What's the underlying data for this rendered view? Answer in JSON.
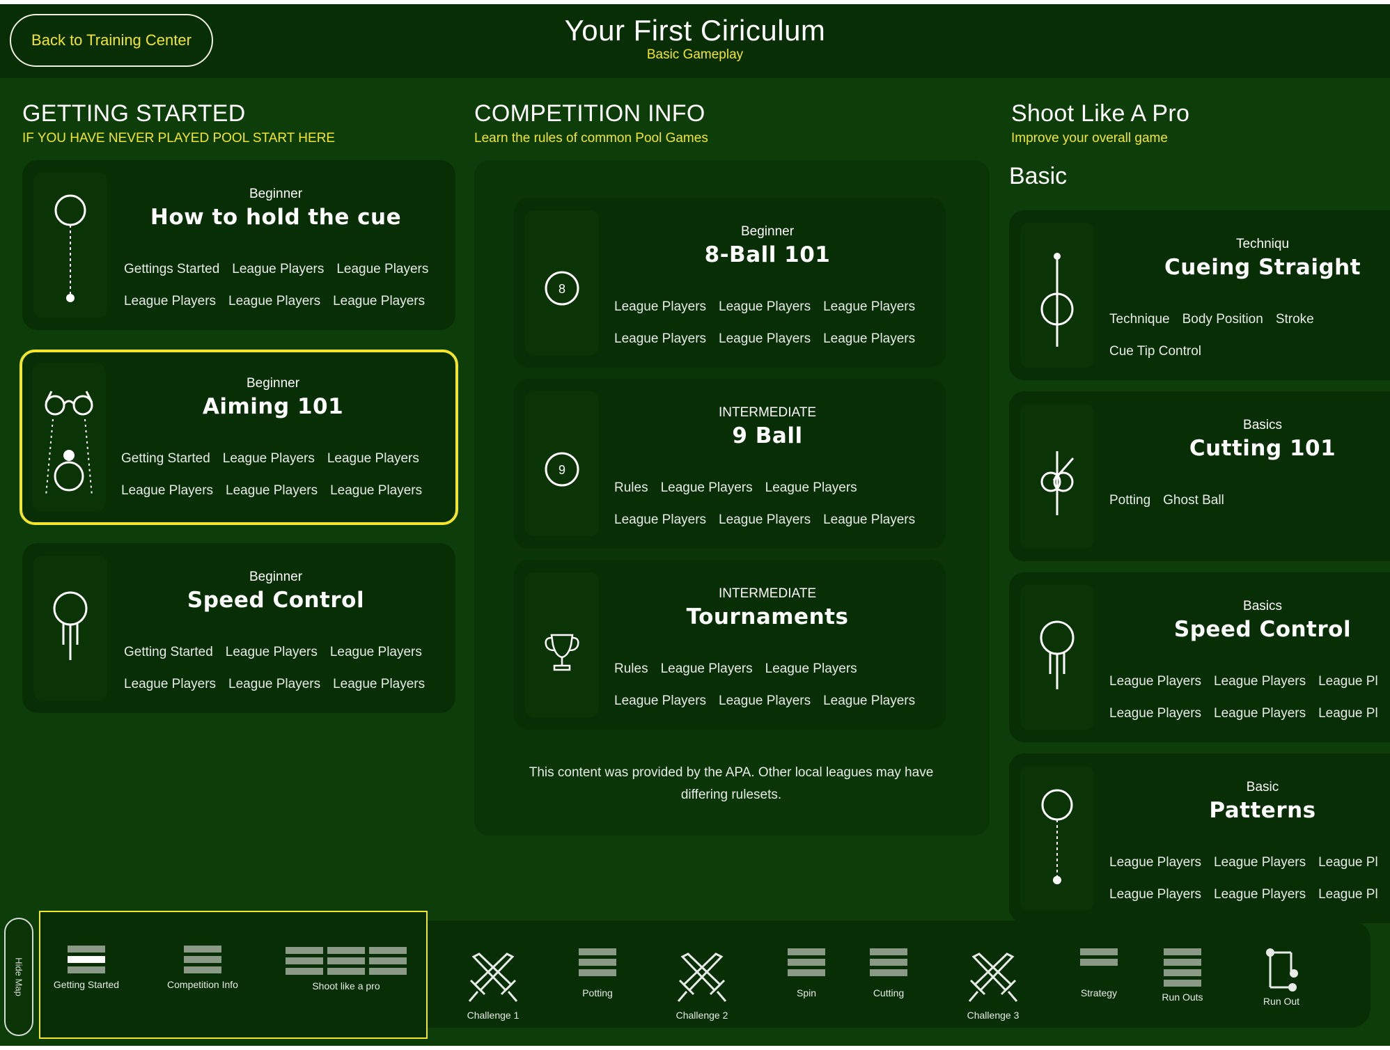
{
  "header": {
    "back_label": "Back to Training Center",
    "title": "Your First Ciriculum",
    "subtitle": "Basic Gameplay"
  },
  "getting_started": {
    "title": "GETTING STARTED",
    "subtitle": "IF YOU HAVE NEVER PLAYED POOL START HERE",
    "cards": [
      {
        "level": "Beginner",
        "title": "How to hold the cue",
        "icon": "cue-grip-icon",
        "tags": [
          "Gettings Started",
          "League Players",
          "League Players",
          "League Players",
          "League Players",
          "League Players"
        ]
      },
      {
        "level": "Beginner",
        "title": "Aiming 101",
        "icon": "aiming-glasses-icon",
        "selected": true,
        "tags": [
          "Getting Started",
          "League Players",
          "League Players",
          "League Players",
          "League Players",
          "League Players"
        ]
      },
      {
        "level": "Beginner",
        "title": "Speed Control",
        "icon": "speed-ball-icon",
        "tags": [
          "Getting Started",
          "League Players",
          "League Players",
          "League Players",
          "League Players",
          "League Players"
        ]
      }
    ]
  },
  "competition_info": {
    "title": "COMPETITION INFO",
    "subtitle": "Learn the rules of common Pool Games",
    "cards": [
      {
        "level": "Beginner",
        "title": "8-Ball 101",
        "icon": "eight-ball-icon",
        "badge": "8",
        "tags": [
          "League Players",
          "League Players",
          "League Players",
          "League Players",
          "League Players",
          "League Players"
        ]
      },
      {
        "level": "INTERMEDIATE",
        "title": "9 Ball",
        "icon": "nine-ball-icon",
        "badge": "9",
        "tags": [
          "Rules",
          "League Players",
          "League Players",
          "League Players",
          "League Players",
          "League Players"
        ]
      },
      {
        "level": "INTERMEDIATE",
        "title": "Tournaments",
        "icon": "trophy-icon",
        "tags": [
          "Rules",
          "League Players",
          "League Players",
          "League Players",
          "League Players",
          "League Players"
        ]
      }
    ],
    "note": "This content was provided by the APA. Other local leagues may have differing rulesets."
  },
  "shoot_like_pro": {
    "title": "Shoot Like A Pro",
    "subtitle": "Improve your overall game",
    "group": "Basic",
    "cards": [
      {
        "level": "Techniqu",
        "title": "Cueing Straight",
        "icon": "cueing-straight-icon",
        "tags": [
          "Technique",
          "Body Position",
          "Stroke",
          "Cue Tip Control"
        ]
      },
      {
        "level": "Basics",
        "title": "Cutting 101",
        "icon": "cutting-icon",
        "tags": [
          "Potting",
          "Ghost Ball"
        ]
      },
      {
        "level": "Basics",
        "title": "Speed Control",
        "icon": "speed-ball-icon",
        "tags": [
          "League Players",
          "League Players",
          "League Pl",
          "League Players",
          "League Players",
          "League Pl"
        ]
      },
      {
        "level": "Basic",
        "title": "Patterns",
        "icon": "patterns-icon",
        "tags": [
          "League Players",
          "League Players",
          "League Pl",
          "League Players",
          "League Players",
          "League Pl"
        ]
      }
    ]
  },
  "map": {
    "hide_label": "Hide Map",
    "items": [
      {
        "label": "Getting Started",
        "icon": "stack-icon"
      },
      {
        "label": "Competition Info",
        "icon": "stack-icon"
      },
      {
        "label": "Shoot like a pro",
        "icon": "stack-triple-icon"
      },
      {
        "label": "Challenge 1",
        "icon": "crossed-swords-icon"
      },
      {
        "label": "Potting",
        "icon": "stack-icon"
      },
      {
        "label": "Challenge 2",
        "icon": "crossed-swords-icon"
      },
      {
        "label": "Spin",
        "icon": "stack-icon"
      },
      {
        "label": "Cutting",
        "icon": "stack-icon"
      },
      {
        "label": "Challenge 3",
        "icon": "crossed-swords-icon"
      },
      {
        "label": "Strategy",
        "icon": "stack-icon"
      },
      {
        "label": "Run Outs",
        "icon": "stack-icon"
      },
      {
        "label": "Run Out",
        "icon": "run-out-icon"
      }
    ]
  },
  "colors": {
    "background": "#0d3d08",
    "card": "#082e05",
    "accent": "#f4e62a",
    "text": "#ffffff"
  }
}
